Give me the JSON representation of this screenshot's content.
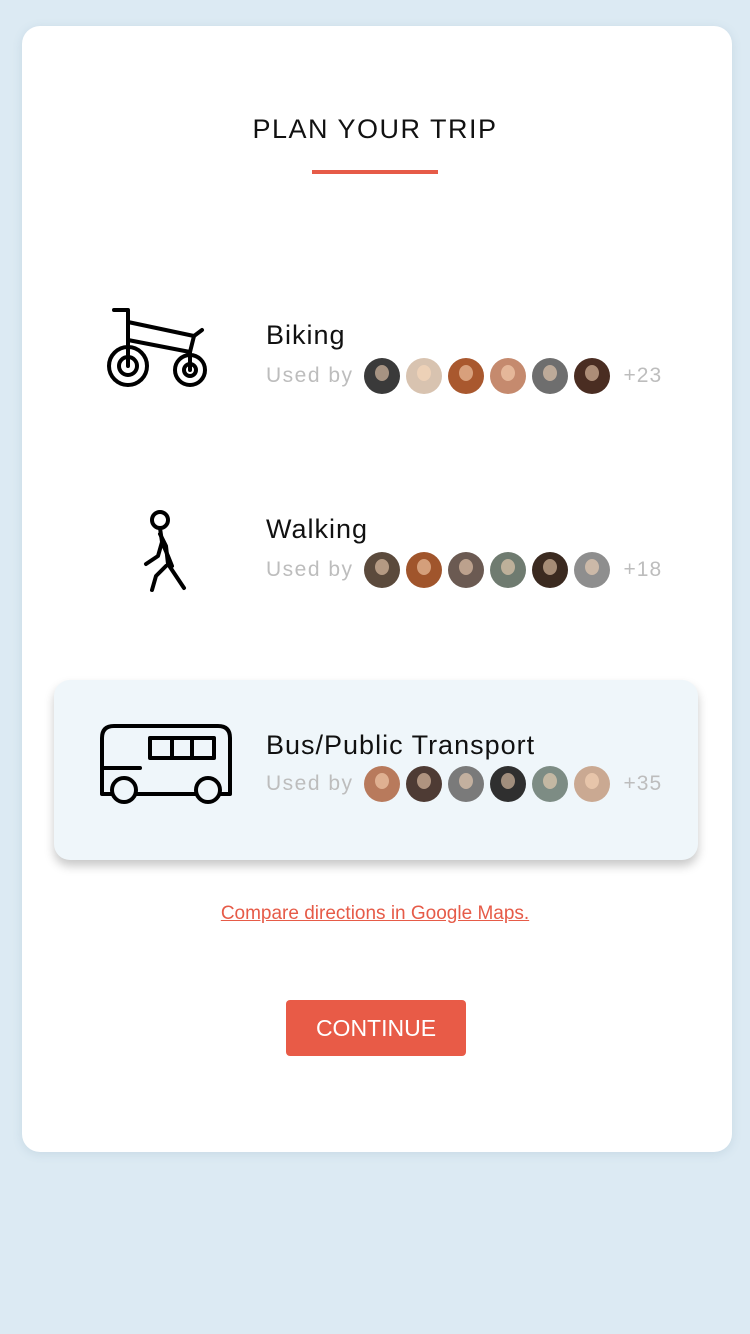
{
  "header": {
    "title": "PLAN YOUR TRIP"
  },
  "colors": {
    "accent": "#e65b48",
    "background": "#dceaf3",
    "selected_card": "#eff6fa"
  },
  "options": [
    {
      "id": "biking",
      "icon": "bicycle-icon",
      "label": "Biking",
      "used_by_label": "Used by",
      "extra_count": "+23",
      "avatar_colors": [
        "#3a3a3a",
        "#d8c3b0",
        "#a9582e",
        "#c58a6e",
        "#6e6e6e",
        "#4a2d22"
      ],
      "selected": false
    },
    {
      "id": "walking",
      "icon": "walking-person-icon",
      "label": "Walking",
      "used_by_label": "Used by",
      "extra_count": "+18",
      "avatar_colors": [
        "#5b4a3c",
        "#a0552c",
        "#6b5a52",
        "#6f7b70",
        "#3b2a20",
        "#8e8e8e"
      ],
      "selected": false
    },
    {
      "id": "bus",
      "icon": "bus-icon",
      "label": "Bus/Public Transport",
      "used_by_label": "Used by",
      "extra_count": "+35",
      "avatar_colors": [
        "#b87a5c",
        "#4e3b34",
        "#7a7a7a",
        "#2f2f2f",
        "#7d8c84",
        "#caa992"
      ],
      "selected": true
    }
  ],
  "footer": {
    "maps_link": "Compare directions in Google Maps.",
    "continue_label": "CONTINUE"
  }
}
